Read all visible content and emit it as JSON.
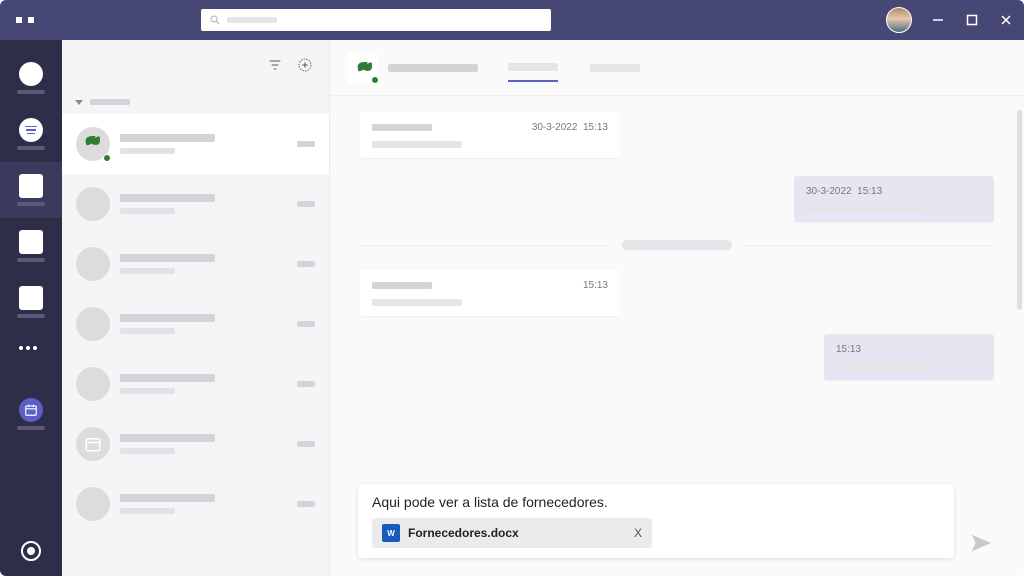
{
  "messages": {
    "received1": {
      "date": "30-3-2022",
      "time": "15:13"
    },
    "sent1": {
      "date": "30-3-2022",
      "time": "15:13"
    },
    "received2": {
      "time": "15:13"
    },
    "sent2": {
      "time": "15:13"
    }
  },
  "composer": {
    "text": "Aqui pode ver a lista de fornecedores.",
    "attachment": {
      "filename": "Fornecedores.docx",
      "icon_label": "W",
      "close_label": "X"
    }
  }
}
